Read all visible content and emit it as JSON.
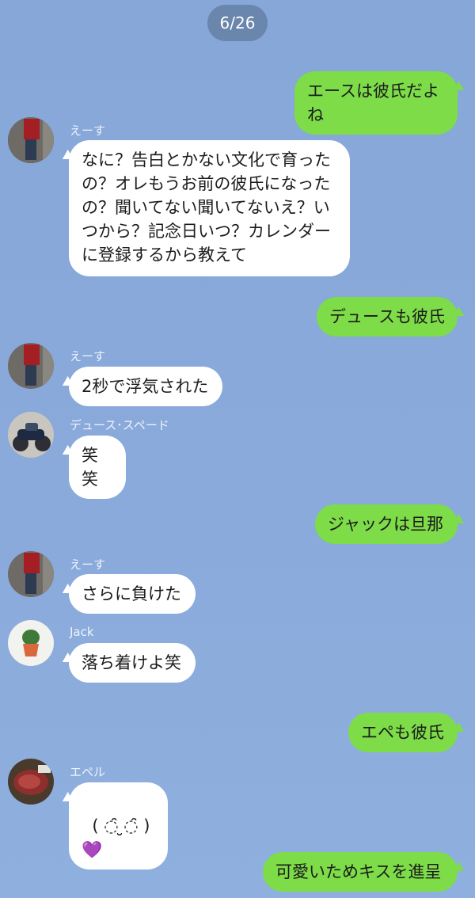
{
  "date_label": "6/26",
  "messages": [
    {
      "text": "エースは彼氏だよね"
    },
    {
      "sender": "えーす",
      "text": "なに？告白とかない文化で育ったの？オレもうお前の彼氏になったの？聞いてない聞いてないえ？いつから？記念日いつ？カレンダーに登録するから教えて"
    },
    {
      "text": "デュースも彼氏"
    },
    {
      "sender": "えーす",
      "text": "2秒で浮気された"
    },
    {
      "sender": "デュース･スペード",
      "text": "笑笑"
    },
    {
      "text": "ジャックは旦那"
    },
    {
      "sender": "えーす",
      "text": "さらに負けた"
    },
    {
      "sender": "Jack",
      "text": "落ち着けよ笑"
    },
    {
      "text": "エペも彼氏"
    },
    {
      "sender": "エペル",
      "text": "( ◌̑ ̮◌̑ )",
      "emoji": "💜"
    },
    {
      "text": "可愛いためキスを進呈"
    }
  ],
  "colors": {
    "background": "#8aaadb",
    "outgoing_bubble": "#7ddc48",
    "incoming_bubble": "#ffffff",
    "date_pill": "#6b86ad"
  }
}
